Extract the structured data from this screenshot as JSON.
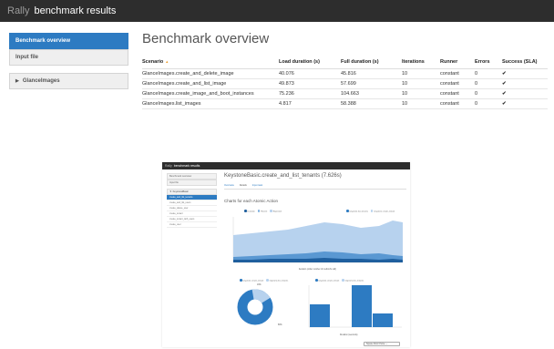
{
  "header": {
    "brand": "Rally",
    "title": "benchmark results"
  },
  "sidebar": {
    "items": [
      {
        "label": "Benchmark overview",
        "active": true
      },
      {
        "label": "Input file",
        "active": false
      }
    ],
    "group": {
      "label": "GlanceImages"
    }
  },
  "main": {
    "title": "Benchmark overview",
    "columns": [
      "Scenario",
      "Load duration (s)",
      "Full duration (s)",
      "Iterations",
      "Runner",
      "Errors",
      "Success (SLA)"
    ],
    "rows": [
      {
        "scenario": "GlanceImages.create_and_delete_image",
        "load": "40.076",
        "full": "45.816",
        "iterations": "10",
        "runner": "constant",
        "errors": "0",
        "success": "✔"
      },
      {
        "scenario": "GlanceImages.create_and_list_image",
        "load": "49.873",
        "full": "57.699",
        "iterations": "10",
        "runner": "constant",
        "errors": "0",
        "success": "✔"
      },
      {
        "scenario": "GlanceImages.create_image_and_boot_instances",
        "load": "75.236",
        "full": "104.663",
        "iterations": "10",
        "runner": "constant",
        "errors": "0",
        "success": "✔"
      },
      {
        "scenario": "GlanceImages.list_images",
        "load": "4.817",
        "full": "58.388",
        "iterations": "10",
        "runner": "constant",
        "errors": "0",
        "success": "✔"
      }
    ]
  },
  "screenshot": {
    "brand": "Rally",
    "title": "benchmark results",
    "side_items": [
      "Benchmark overview",
      "Input file"
    ],
    "group": "KeystoneBasic",
    "sub_items": [
      "create_and_list_tenants",
      "create_and_list_users",
      "create_delete_user",
      "create_tenant",
      "create_tenant_with_users",
      "create_user"
    ],
    "scenario_title": "KeystoneBasic.create_and_list_tenants (7.626s)",
    "tabs": [
      "Overview",
      "Details",
      "Input task"
    ],
    "section": "Charts for each Atomic Action",
    "legend_left": [
      "Duration",
      "Recent",
      "Expected"
    ],
    "legend_right": [
      "keystone.list_tenants",
      "keystone.create_tenant"
    ],
    "x_axis_label": "Iteration (order number of method's call)",
    "donut_legend": [
      "keystone.create_tenant",
      "keystone.list_tenants"
    ],
    "donut_small": "19%",
    "donut_big": "80%",
    "bar_legend": [
      "keystone.create_tenant",
      "keystone.list_tenants"
    ],
    "bar_axis_label": "Duration (seconds)",
    "select_label": "Square Root Choice"
  },
  "colors": {
    "accent": "#2d7bc2",
    "topbar": "#2d2d2d",
    "success": "#2ba12b"
  }
}
